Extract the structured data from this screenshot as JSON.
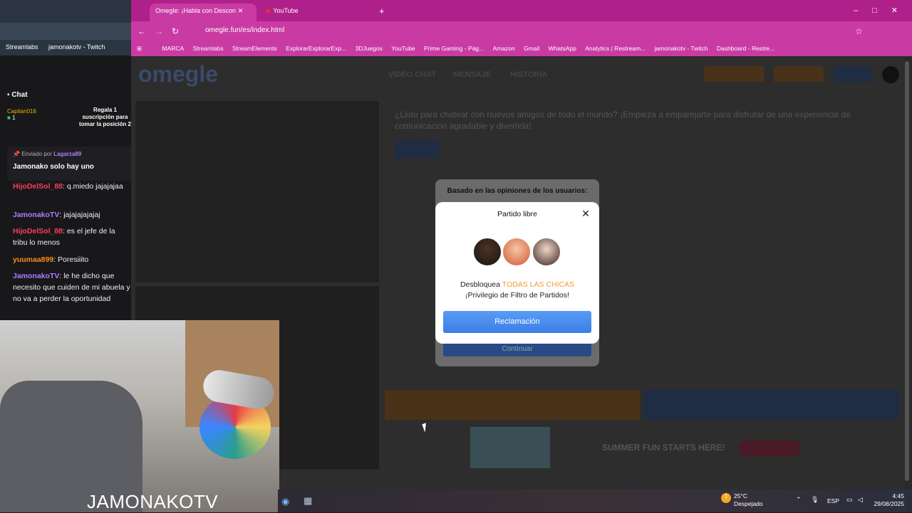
{
  "left_window": {
    "bookmarks": [
      "Streamlabs",
      "jamonakotv - Twitch"
    ],
    "chat_title": "Chat",
    "gift": {
      "user": "Capitan016",
      "count": "1",
      "notice": "Regala 1 suscripción para tomar la posición",
      "position": "2"
    },
    "pinned": {
      "sent_by": "Enviado por",
      "user": "Lagarza89",
      "message": "Jamonako solo hay uno"
    },
    "messages": [
      {
        "user": "HijoDelSol_88",
        "text": ": q.miedo jajajajaa"
      },
      {
        "user": "JamonakoTV",
        "text": ": jajajajajajaj"
      },
      {
        "user": "HijoDelSol_88",
        "text": ": es el jefe de la tribu lo menos"
      },
      {
        "user": "yuumaa899",
        "text": ": Poresiiito"
      },
      {
        "user": "JamonakoTV",
        "text": ": le he dicho que necesito que cuiden de mi abuela y no va a perder la oportunidad"
      }
    ]
  },
  "webcam": {
    "watermark": "JAMONAKOTV"
  },
  "browser": {
    "tabs": [
      {
        "label": "Omegle: ¡Habla con Descon"
      },
      {
        "label": "YouTube"
      }
    ],
    "url": "omegle.fun/es/index.html",
    "bookmarks": [
      "MARCA",
      "Streamlabs",
      "StreamElements",
      "ExplorarExplorarExp...",
      "3DJuegos",
      "YouTube",
      "Prime Gaming - Pág...",
      "Amazon",
      "Gmail",
      "WhatsApp",
      "Analytics | Restream...",
      "jamonakotv - Twitch",
      "Dashboard - Restre..."
    ]
  },
  "page": {
    "logo": "omegle",
    "nav": [
      "VIDEO CHAT",
      "MENSAJE",
      "HISTORIA"
    ],
    "intro": "¿Listo para chatear con nuevos amigos de todo el mundo? ¡Empieza a emparejarte para disfrutar de una experiencia de comunicación agradable y divertida!",
    "ad_text": "SUMMER FUN STARTS HERE!"
  },
  "modal": {
    "backdrop_title": "Basado en las opiniones de los usuarios:",
    "title": "Partido libre",
    "text_before": "Desbloquea ",
    "highlight": "TODAS LAS CHICAS",
    "text_after": " ¡Privilegio de Filtro de Partidos!",
    "button": "Reclamación",
    "ghost_button": "Continuar"
  },
  "taskbar": {
    "weather_temp": "25°C",
    "weather_desc": "Despejado",
    "weather_badge": "1",
    "lang": "ESP",
    "time": "4:45",
    "date": "29/08/2025"
  },
  "colors": {
    "tabbar": "#b0208a",
    "highlight": "#f19b2c",
    "button": "#3b7ee6"
  }
}
